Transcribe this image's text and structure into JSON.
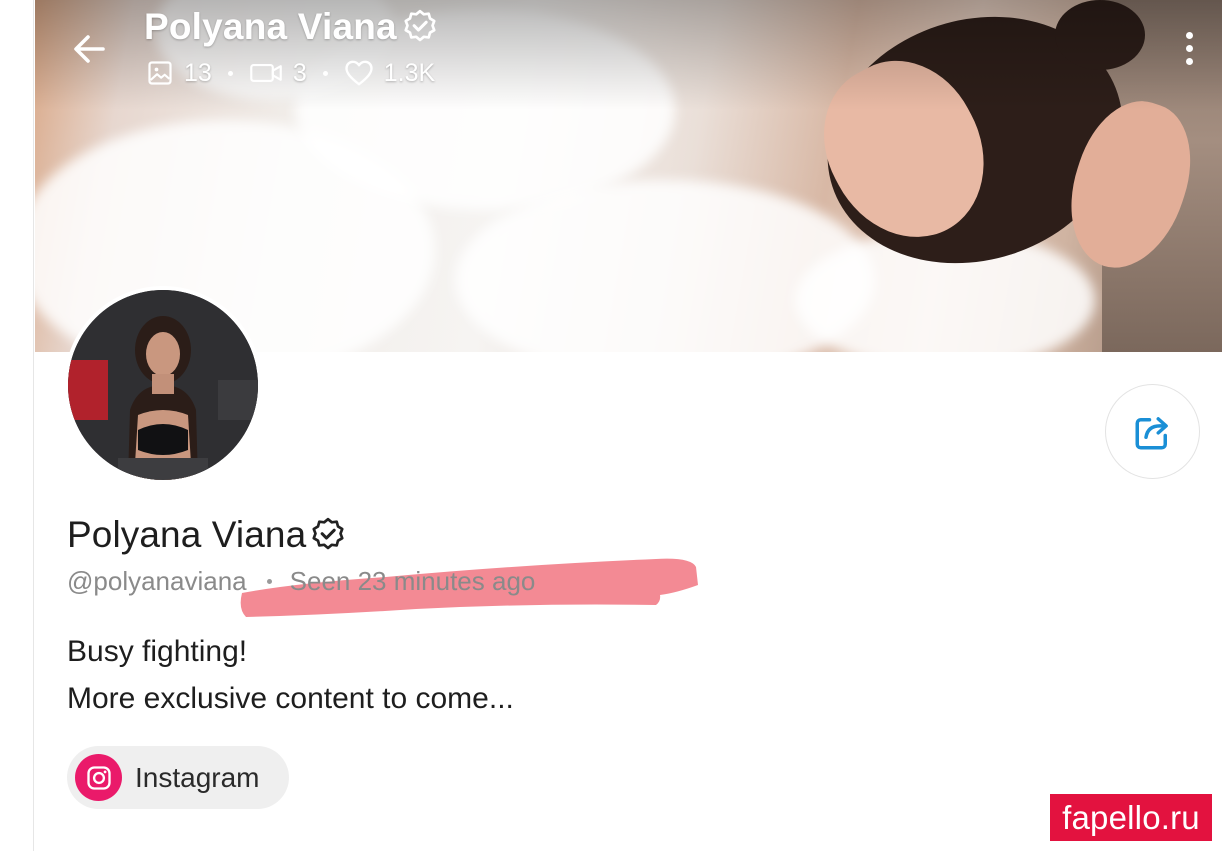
{
  "header": {
    "name": "Polyana Viana",
    "stats": {
      "photos": "13",
      "videos": "3",
      "likes": "1.3K"
    }
  },
  "profile": {
    "name": "Polyana Viana",
    "handle": "@polyanaviana",
    "last_seen": "Seen  23 minutes ago",
    "bio_lines": [
      "Busy fighting!",
      "More exclusive content to come..."
    ]
  },
  "links": {
    "instagram_label": "Instagram"
  },
  "watermark": "fapello.ru",
  "colors": {
    "instagram": "#ea1a6a",
    "share_accent": "#1a8fd6",
    "watermark_bg": "#e3123f",
    "highlight_marker": "#f0707c"
  },
  "icons": {
    "back": "arrow-left-icon",
    "photo": "image-icon",
    "video": "video-camera-icon",
    "likes": "heart-icon",
    "verified": "verified-badge-icon",
    "more": "kebab-menu-icon",
    "share": "share-icon",
    "instagram": "instagram-icon"
  }
}
